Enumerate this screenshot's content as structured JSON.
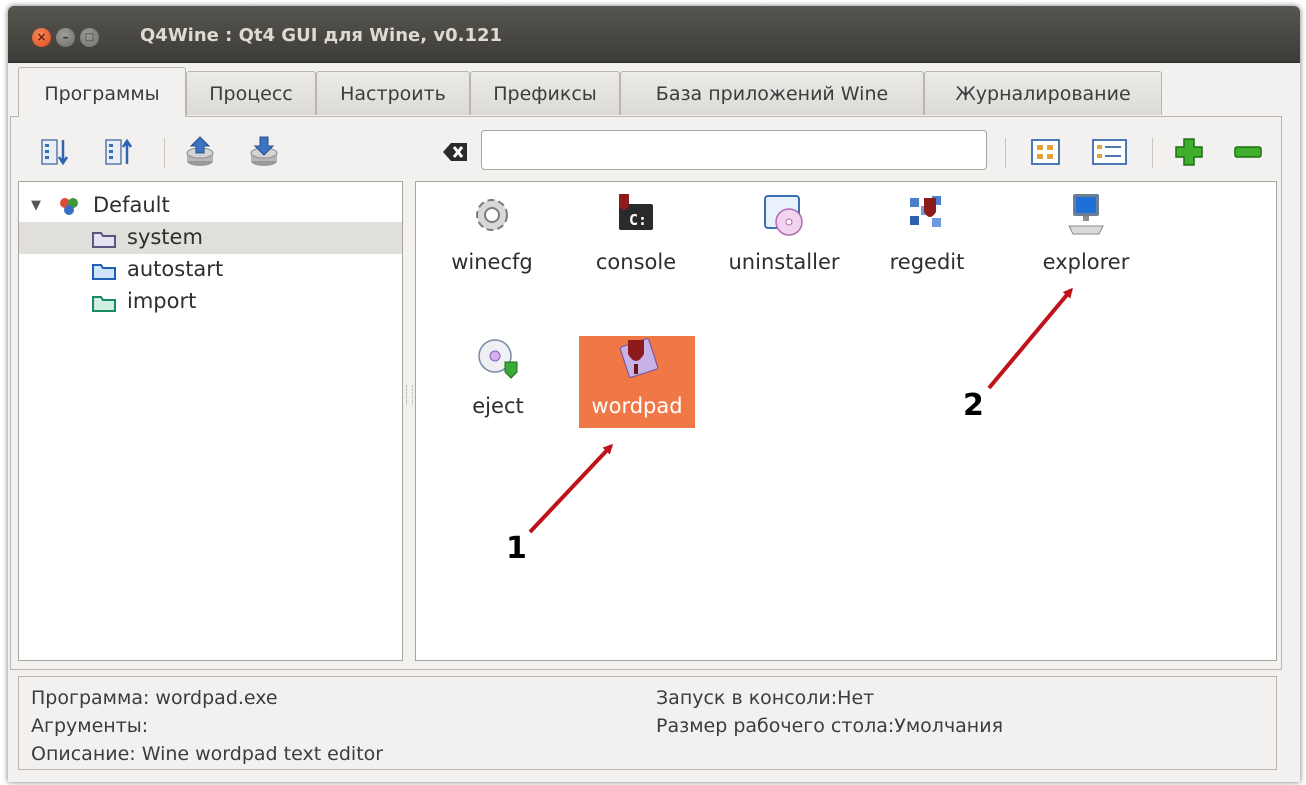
{
  "window": {
    "title": "Q4Wine : Qt4 GUI для Wine, v0.121",
    "close_glyph": "×",
    "min_glyph": "–",
    "max_glyph": "□"
  },
  "tabs": [
    {
      "label": "Программы",
      "active": true
    },
    {
      "label": "Процесс"
    },
    {
      "label": "Настроить"
    },
    {
      "label": "Префиксы"
    },
    {
      "label": "База приложений Wine"
    },
    {
      "label": "Журналирование"
    }
  ],
  "toolbar": {
    "icons": [
      "sort-down-icon",
      "sort-up-icon",
      "export-icon",
      "import-icon",
      "clear-search-icon",
      "icon-view-icon",
      "list-view-icon",
      "add-icon",
      "remove-icon"
    ],
    "search_value": ""
  },
  "tree": {
    "root": "Default",
    "expander": "▼",
    "children": [
      "system",
      "autostart",
      "import"
    ],
    "selected": "system"
  },
  "programs": [
    {
      "label": "winecfg",
      "icon": "gear-icon"
    },
    {
      "label": "console",
      "icon": "console-icon"
    },
    {
      "label": "uninstaller",
      "icon": "uninstaller-icon"
    },
    {
      "label": "regedit",
      "icon": "regedit-icon"
    },
    {
      "label": "explorer",
      "icon": "computer-icon"
    },
    {
      "label": "eject",
      "icon": "eject-disc-icon"
    },
    {
      "label": "wordpad",
      "icon": "wine-icon",
      "selected": true
    }
  ],
  "info": {
    "program": "Программа: wordpad.exe",
    "arguments": "Агрументы:",
    "description": "Описание: Wine wordpad text editor",
    "console": "Запуск в консоли:Нет",
    "desktop": "Размер рабочего стола:Умолчания"
  },
  "annotations": {
    "one": "1",
    "two": "2",
    "arrow_color": "#c0121a"
  },
  "colors": {
    "selection": "#f07746",
    "titlebar": "#3d3c38",
    "close_button": "#df4a16"
  }
}
